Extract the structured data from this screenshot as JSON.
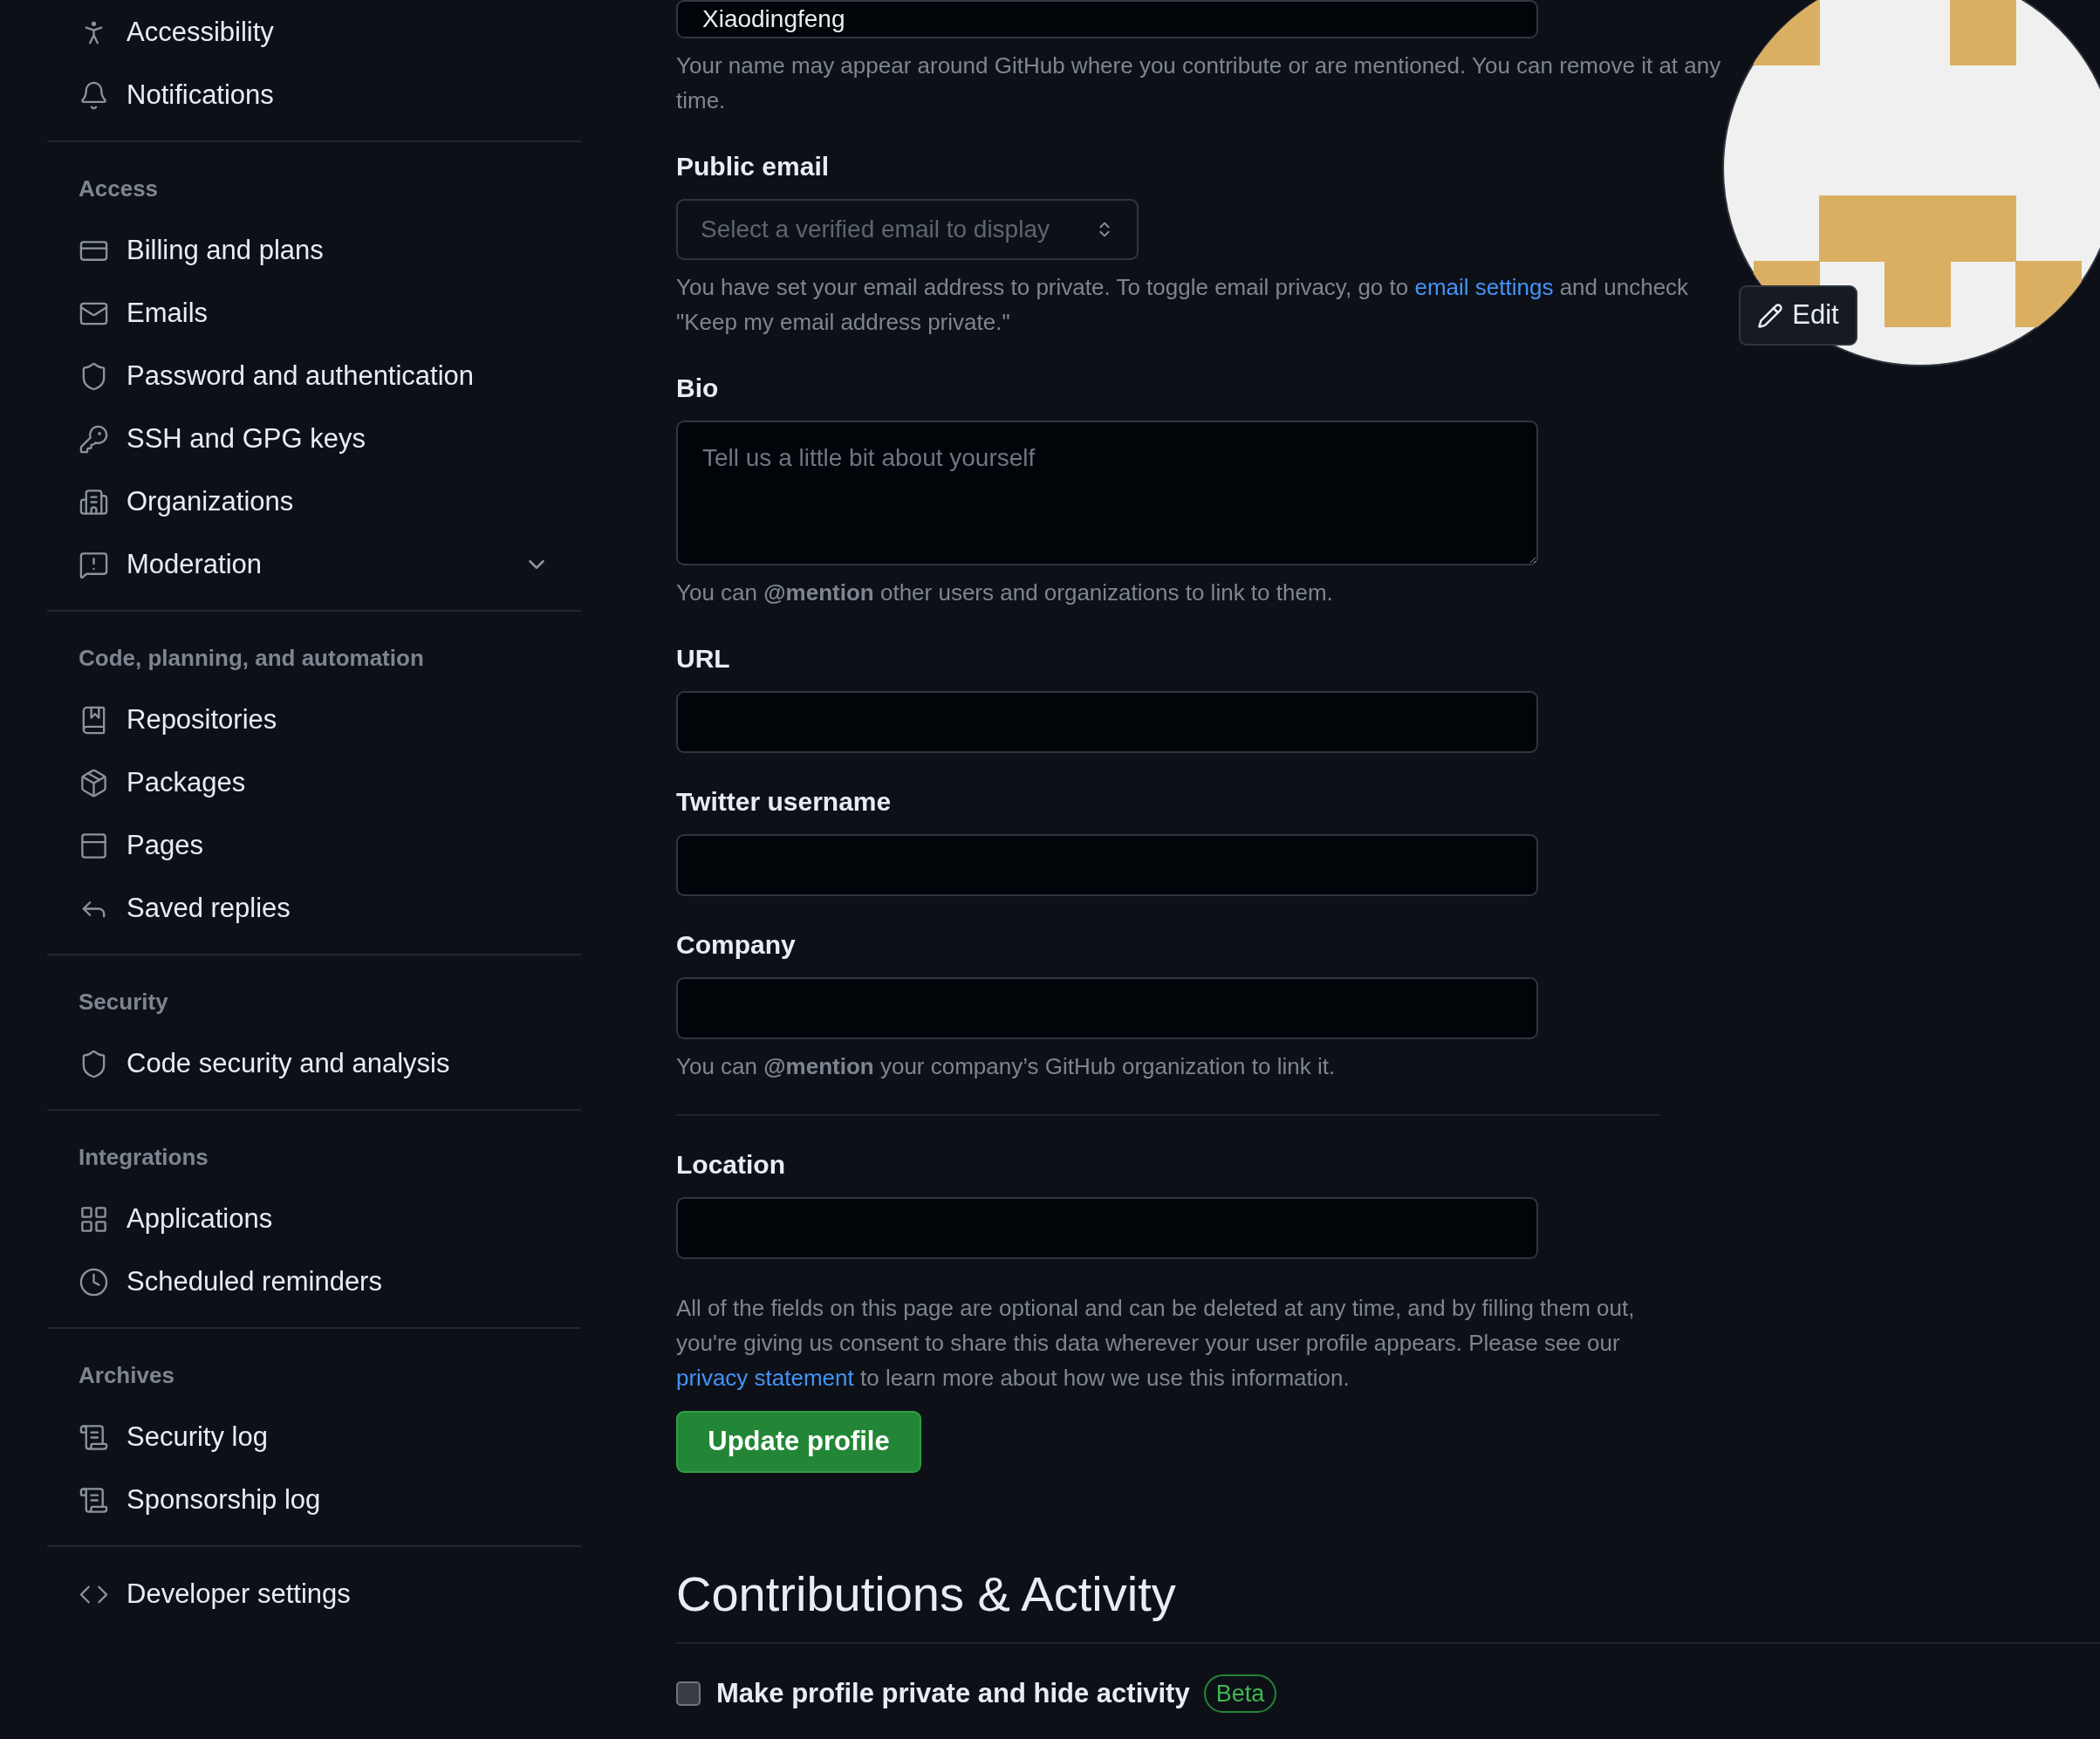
{
  "sidebar": {
    "sections": [
      {
        "items": [
          {
            "label": "Accessibility",
            "kind": "link"
          },
          {
            "label": "Notifications",
            "kind": "link"
          }
        ]
      },
      {
        "heading": "Access",
        "items": [
          {
            "label": "Billing and plans",
            "kind": "link"
          },
          {
            "label": "Emails",
            "kind": "link"
          },
          {
            "label": "Password and authentication",
            "kind": "link"
          },
          {
            "label": "SSH and GPG keys",
            "kind": "link"
          },
          {
            "label": "Organizations",
            "kind": "link"
          },
          {
            "label": "Moderation",
            "kind": "collapsible"
          }
        ]
      },
      {
        "heading": "Code, planning, and automation",
        "items": [
          {
            "label": "Repositories",
            "kind": "link"
          },
          {
            "label": "Packages",
            "kind": "link"
          },
          {
            "label": "Pages",
            "kind": "link"
          },
          {
            "label": "Saved replies",
            "kind": "link"
          }
        ]
      },
      {
        "heading": "Security",
        "items": [
          {
            "label": "Code security and analysis",
            "kind": "link"
          }
        ]
      },
      {
        "heading": "Integrations",
        "items": [
          {
            "label": "Applications",
            "kind": "link"
          },
          {
            "label": "Scheduled reminders",
            "kind": "link"
          }
        ]
      },
      {
        "heading": "Archives",
        "items": [
          {
            "label": "Security log",
            "kind": "link"
          },
          {
            "label": "Sponsorship log",
            "kind": "link"
          }
        ]
      },
      {
        "items": [
          {
            "label": "Developer settings",
            "kind": "link"
          }
        ]
      }
    ]
  },
  "form": {
    "fields": [
      {
        "kind": "text",
        "value": "Xiaodingfeng",
        "hint": [
          {
            "text": "Your name may appear around GitHub where you contribute or are mentioned. You can remove it at any time."
          }
        ]
      },
      {
        "kind": "select",
        "label": "Public email",
        "placeholder": "Select a verified email to display",
        "hint": [
          {
            "text": "You have set your email address to private. To toggle email privacy, go to"
          },
          {
            "link": "email settings"
          },
          {
            "text": "and uncheck \"Keep my email address private.\""
          }
        ]
      },
      {
        "kind": "textarea",
        "label": "Bio",
        "placeholder": "Tell us a little bit about yourself",
        "hint": [
          {
            "text": "You can **@mention** other users and organizations to link to them."
          }
        ]
      },
      {
        "kind": "text",
        "label": "URL"
      },
      {
        "kind": "text",
        "label": "Twitter username"
      },
      {
        "kind": "text",
        "label": "Company",
        "hint": [
          {
            "text": "You can **@mention** your company’s GitHub organization to link it."
          }
        ]
      },
      {
        "kind": "divider"
      },
      {
        "kind": "text",
        "label": "Location"
      }
    ],
    "notice": [
      {
        "text": "All of the fields on this page are optional and can be deleted at any time, and by filling them out, you're giving us consent to share this data wherever your user profile appears. Please see our"
      },
      {
        "link": "privacy statement"
      },
      {
        "text": "to learn more about how we use this information."
      }
    ],
    "submit": "Update profile"
  },
  "avatar": {
    "edit": "Edit"
  },
  "contributions": {
    "heading": "Contributions & Activity",
    "options": [
      {
        "label": "Make profile private and hide activity",
        "checked": false,
        "badge": "Beta"
      }
    ]
  }
}
